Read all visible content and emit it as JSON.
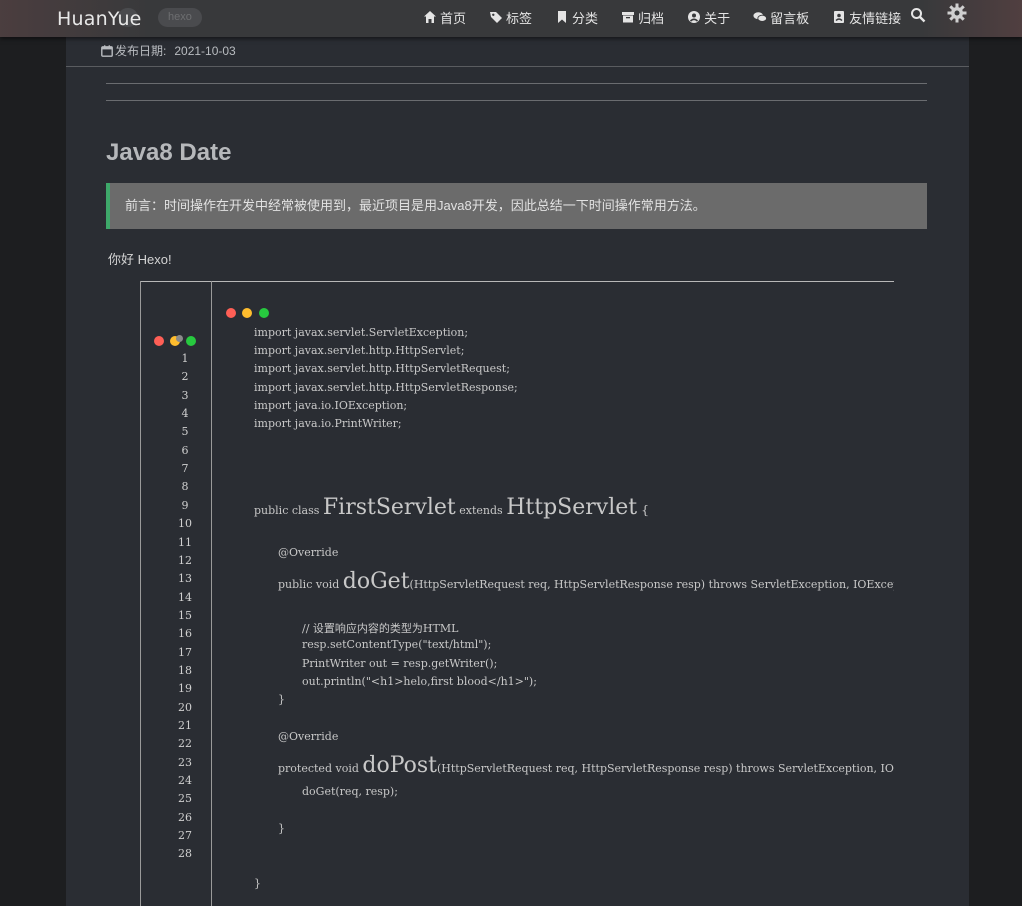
{
  "nav": {
    "brand": "HuanYue",
    "ghost_tags": [
      "",
      "hexo"
    ],
    "menu": [
      {
        "label": "首页",
        "icon": "home-icon"
      },
      {
        "label": "标签",
        "icon": "tag-icon"
      },
      {
        "label": "分类",
        "icon": "bookmark-icon"
      },
      {
        "label": "归档",
        "icon": "archive-icon"
      },
      {
        "label": "关于",
        "icon": "user-circle-icon"
      },
      {
        "label": "留言板",
        "icon": "comments-icon"
      },
      {
        "label": "友情链接",
        "icon": "address-book-icon"
      }
    ],
    "search_icon": "search-icon",
    "settings_icon": "gear-icon"
  },
  "post": {
    "date_label": "发布日期:",
    "date_value": "2021-10-03",
    "title": "Java8 Date",
    "note": "前言：时间操作在开发中经常被使用到，最近项目是用Java8开发，因此总结一下时间操作常用方法。",
    "hello": "你好 Hexo!"
  },
  "code": {
    "line_numbers": [
      "1",
      "2",
      "3",
      "4",
      "5",
      "6",
      "7",
      "8",
      "9",
      "10",
      "11",
      "12",
      "13",
      "14",
      "15",
      "16",
      "17",
      "18",
      "19",
      "20",
      "21",
      "22",
      "23",
      "24",
      "25",
      "26",
      "27",
      "28"
    ],
    "imports": [
      "import javax.servlet.ServletException;",
      "import javax.servlet.http.HttpServlet;",
      "import javax.servlet.http.HttpServletRequest;",
      "import javax.servlet.http.HttpServletResponse;",
      "import java.io.IOException;",
      "import java.io.PrintWriter;"
    ],
    "class_decl": {
      "pre": "public class ",
      "name": "FirstServlet",
      "mid": " extends ",
      "parent": "HttpServlet",
      "post": " {"
    },
    "override1": "@Override",
    "doget": {
      "pre": "public void ",
      "name": "doGet",
      "post": "(HttpServletRequest req, HttpServletResponse resp) throws ServletException, IOException {"
    },
    "body": [
      "// 设置响应内容的类型为HTML",
      "resp.setContentType(\"text/html\");",
      "PrintWriter out = resp.getWriter();",
      "out.println(\"<h1>helo,first blood</h1>\");"
    ],
    "close1": "}",
    "override2": "@Override",
    "dopost": {
      "pre": "protected void ",
      "name": "doPost",
      "post": "(HttpServletRequest req, HttpServletResponse resp) throws ServletException, IOException {"
    },
    "dopost_body": "doGet(req, resp);",
    "close2": "}",
    "close3": "}"
  },
  "colors": {
    "dot_red": "#ff5f56",
    "dot_yellow": "#ffbd2e",
    "dot_green": "#27c93f",
    "note_border": "#3ea86a"
  }
}
